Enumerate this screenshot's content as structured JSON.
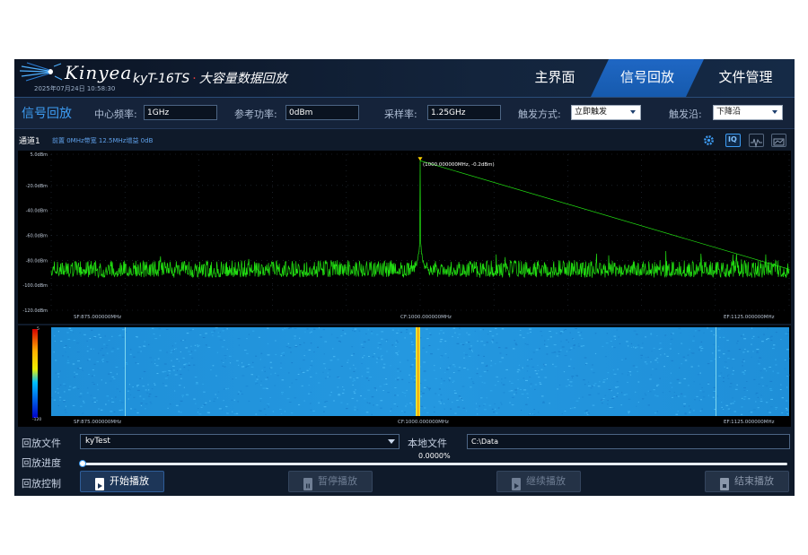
{
  "header": {
    "brand": "Kinyea",
    "product": "kyT-16TS",
    "product_dot": "·",
    "subtitle": "大容量数据回放",
    "datetime": "2025年07月24日 10:58:30",
    "tabs": [
      {
        "label": "主界面",
        "active": false
      },
      {
        "label": "信号回放",
        "active": true
      },
      {
        "label": "文件管理",
        "active": false
      }
    ]
  },
  "toolbar": {
    "title": "信号回放",
    "center_freq_label": "中心频率:",
    "center_freq_value": "1GHz",
    "ref_power_label": "参考功率:",
    "ref_power_value": "0dBm",
    "sample_rate_label": "采样率:",
    "sample_rate_value": "1.25GHz",
    "trigger_mode_label": "触发方式:",
    "trigger_mode_value": "立即触发",
    "trigger_edge_label": "触发沿:",
    "trigger_edge_value": "下降沿"
  },
  "channel": {
    "name": "通道1",
    "info": "前置 0MHz带宽 12.5MHz增益 0dB",
    "iq_label": "IQ"
  },
  "spectrum": {
    "y_ticks": [
      "5.0dBm",
      "-20.0dBm",
      "-40.0dBm",
      "-60.0dBm",
      "-80.0dBm",
      "-100.0dBm",
      "-120.0dBm"
    ],
    "y_tick_values": [
      5,
      -20,
      -40,
      -60,
      -80,
      -100,
      -120
    ],
    "ylim": [
      -120,
      5
    ],
    "sf_label": "SF:875.000000MHz",
    "cf_label": "CF:1000.000000MHz",
    "ef_label": "EF:1125.000000MHz",
    "marker_label": "(1000.000000MHz, -0.2dBm)",
    "marker_freq_mhz": 1000.0,
    "marker_power_dbm": -0.2,
    "noise_floor_dbm": -88,
    "xlim_mhz": [
      875,
      1125
    ]
  },
  "waterfall": {
    "scale_top": "5",
    "scale_bottom": "-120",
    "sf_label": "SF:875.000000MHz",
    "cf_label": "CF:1000.000000MHz",
    "ef_label": "EF:1125.000000MHz"
  },
  "playback": {
    "file_label": "回放文件",
    "file_value": "kyTest",
    "local_label": "本地文件",
    "local_value": "C:\\Data",
    "progress_label": "回放进度",
    "progress_text": "0.0000%",
    "progress_fraction": 0.0,
    "control_label": "回放控制",
    "start_label": "开始播放",
    "pause_label": "暂停播放",
    "resume_label": "继续播放",
    "stop_label": "结束播放"
  },
  "colors": {
    "accent": "#3d9cf3",
    "trace": "#22e012",
    "background": "#0f1a2a"
  }
}
